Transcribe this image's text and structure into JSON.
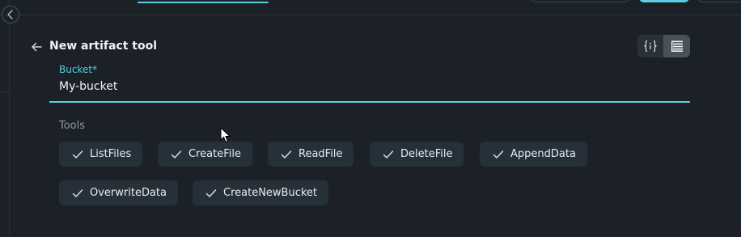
{
  "header": {
    "title": "New artifact tool"
  },
  "bucket_field": {
    "label": "Bucket*",
    "value": "My-bucket"
  },
  "tools": {
    "label": "Tools",
    "items": [
      {
        "label": "ListFiles",
        "selected": true
      },
      {
        "label": "CreateFile",
        "selected": true
      },
      {
        "label": "ReadFile",
        "selected": true
      },
      {
        "label": "DeleteFile",
        "selected": true
      },
      {
        "label": "AppendData",
        "selected": true
      },
      {
        "label": "OverwriteData",
        "selected": true
      },
      {
        "label": "CreateNewBucket",
        "selected": true
      }
    ]
  },
  "view_toggle": {
    "options": [
      "json-view-icon",
      "form-view-icon"
    ],
    "active": "form-view-icon"
  },
  "colors": {
    "background": "#1b2127",
    "accent": "#5bcfe0",
    "chip_background": "#263039"
  }
}
